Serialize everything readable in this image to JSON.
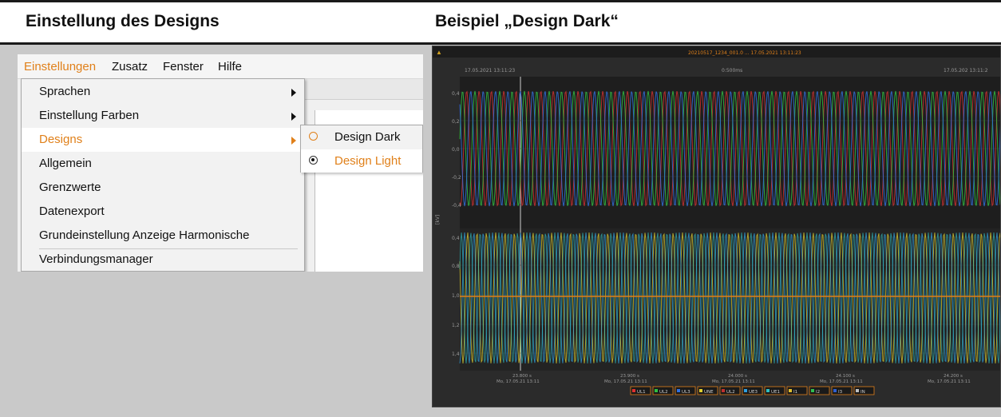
{
  "header": {
    "left_title": "Einstellung des Designs",
    "right_title": "Beispiel „Design Dark“"
  },
  "menubar": {
    "items": [
      "Einstellungen",
      "Zusatz",
      "Fenster",
      "Hilfe"
    ]
  },
  "settings_menu": {
    "items": [
      {
        "label": "Sprachen",
        "submenu": true
      },
      {
        "label": "Einstellung Farben",
        "submenu": true
      },
      {
        "label": "Designs",
        "submenu": true,
        "selected": true
      },
      {
        "label": "Allgemein",
        "submenu": false
      },
      {
        "label": "Grenzwerte",
        "submenu": false
      },
      {
        "label": "Datenexport",
        "submenu": false
      },
      {
        "label": "Grundeinstellung Anzeige Harmonische",
        "submenu": false
      },
      {
        "label": "Verbindungsmanager",
        "submenu": false
      }
    ]
  },
  "designs_submenu": {
    "items": [
      {
        "label": "Design Dark",
        "checked": false
      },
      {
        "label": "Design Light",
        "checked": true
      }
    ]
  },
  "colors": {
    "accent": "#e0801a",
    "dark_bg": "#2b2b2b",
    "plot_bg": "#1f1f1f"
  },
  "dark_view": {
    "title_bar": "20210517_1234_001.0 ... 17.05.2021 13:11:23",
    "time_left": "17.05.2021 13:11:23",
    "time_center": "0:500ms",
    "time_right": "17.05.202 13:11:2",
    "ylabel": "[kV]",
    "upper_ticks": [
      "0,4",
      "0,2",
      "0,0",
      "-0,2",
      "-0,4"
    ],
    "lower_ticks": [
      "0,4",
      "0,8",
      "1,0",
      "1,2",
      "1,4"
    ],
    "x_ticks": [
      {
        "t": "23.800 s",
        "d": "Mo, 17.05.21 13:11"
      },
      {
        "t": "23.900 s",
        "d": "Mo, 17.05.21 13:11"
      },
      {
        "t": "24.000 s",
        "d": "Mo, 17.05.21 13:11"
      },
      {
        "t": "24.100 s",
        "d": "Mo, 17.05.21 13:11"
      },
      {
        "t": "24.200 s",
        "d": "Mo, 17.05.21 13:11"
      }
    ],
    "legend": [
      {
        "label": "UL1",
        "color": "#e03030"
      },
      {
        "label": "UL2",
        "color": "#30c040"
      },
      {
        "label": "UL3",
        "color": "#3070e0"
      },
      {
        "label": "UNE",
        "color": "#e0d030"
      },
      {
        "label": "UL2",
        "color": "#c03030"
      },
      {
        "label": "UE3",
        "color": "#30a0e0"
      },
      {
        "label": "UE1",
        "color": "#30c0c0"
      },
      {
        "label": "I1",
        "color": "#e0c030"
      },
      {
        "label": "I2",
        "color": "#30c050"
      },
      {
        "label": "I3",
        "color": "#3060d0"
      },
      {
        "label": "IN",
        "color": "#c0c0c0"
      }
    ]
  }
}
